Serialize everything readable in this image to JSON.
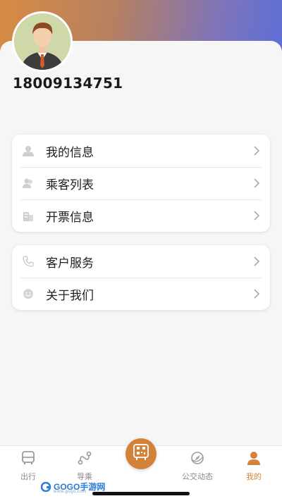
{
  "profile": {
    "phone": "18009134751"
  },
  "menu_group_1": [
    {
      "label": "我的信息",
      "icon": "user-icon"
    },
    {
      "label": "乘客列表",
      "icon": "passengers-icon"
    },
    {
      "label": "开票信息",
      "icon": "building-icon"
    }
  ],
  "menu_group_2": [
    {
      "label": "客户服务",
      "icon": "phone-icon"
    },
    {
      "label": "关于我们",
      "icon": "smile-icon"
    }
  ],
  "tabbar": {
    "items": [
      {
        "label": "出行",
        "icon": "bus-icon"
      },
      {
        "label": "导乘",
        "icon": "route-icon"
      },
      {
        "label": "",
        "icon": "qr-bus-icon"
      },
      {
        "label": "公交动态",
        "icon": "compass-icon"
      },
      {
        "label": "我的",
        "icon": "person-icon"
      }
    ],
    "active": "我的"
  },
  "watermark": {
    "text": "GOGO手游网",
    "sub": "www.gogo.com"
  },
  "colors": {
    "accent": "#d3823a",
    "gradient_left": "#d88b43",
    "gradient_right": "#5b6fd8"
  }
}
